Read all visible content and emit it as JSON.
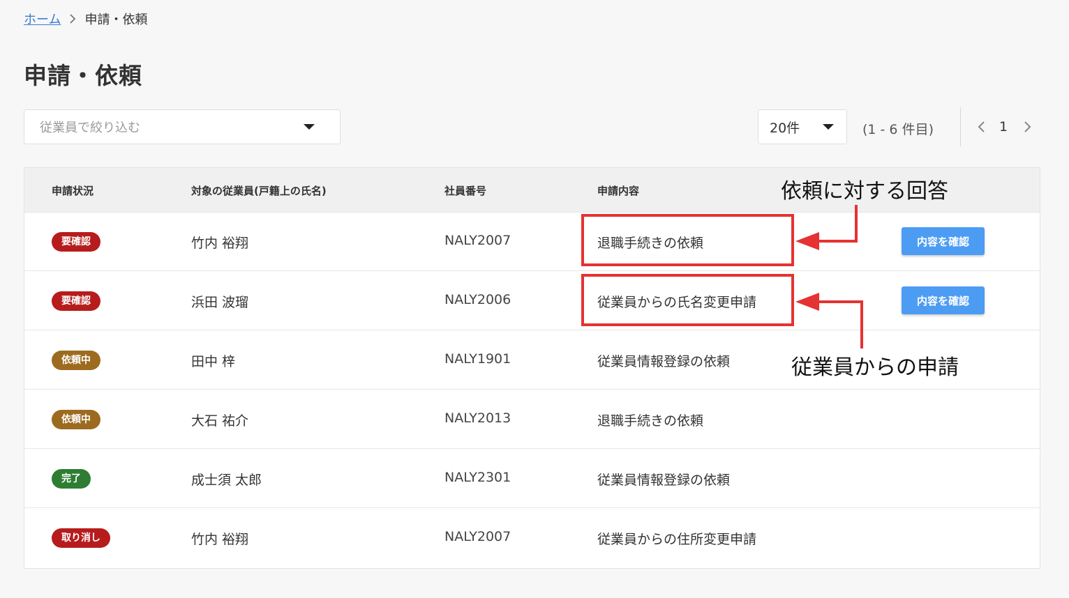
{
  "breadcrumb": {
    "home": "ホーム",
    "current": "申請・依頼"
  },
  "page": {
    "title": "申請・依頼"
  },
  "filter": {
    "employee_placeholder": "従業員で絞り込む",
    "per_page_value": "20件",
    "range_text": "(1 - 6 件目)",
    "current_page": "1"
  },
  "table": {
    "headers": {
      "status": "申請状況",
      "employee": "対象の従業員(戸籍上の氏名)",
      "employee_id": "社員番号",
      "content": "申請内容"
    },
    "rows": [
      {
        "status": "要確認",
        "status_color": "#b71c1c",
        "name": "竹内 裕翔",
        "employee_id": "NALY2007",
        "content": "退職手続きの依頼",
        "action": "内容を確認"
      },
      {
        "status": "要確認",
        "status_color": "#b71c1c",
        "name": "浜田 波瑠",
        "employee_id": "NALY2006",
        "content": "従業員からの氏名変更申請",
        "action": "内容を確認"
      },
      {
        "status": "依頼中",
        "status_color": "#9c6b1f",
        "name": "田中 梓",
        "employee_id": "NALY1901",
        "content": "従業員情報登録の依頼"
      },
      {
        "status": "依頼中",
        "status_color": "#9c6b1f",
        "name": "大石 祐介",
        "employee_id": "NALY2013",
        "content": "退職手続きの依頼"
      },
      {
        "status": "完了",
        "status_color": "#2e7d32",
        "name": "成士須 太郎",
        "employee_id": "NALY2301",
        "content": "従業員情報登録の依頼"
      },
      {
        "status": "取り消し",
        "status_color": "#b71c1c",
        "name": "竹内 裕翔",
        "employee_id": "NALY2007",
        "content": "従業員からの住所変更申請"
      }
    ]
  },
  "annotations": {
    "request_response": "依頼に対する回答",
    "employee_application": "従業員からの申請",
    "color": "#e53232"
  },
  "colors": {
    "link": "#3a7bd5",
    "primary_button": "#4c9cf3"
  }
}
